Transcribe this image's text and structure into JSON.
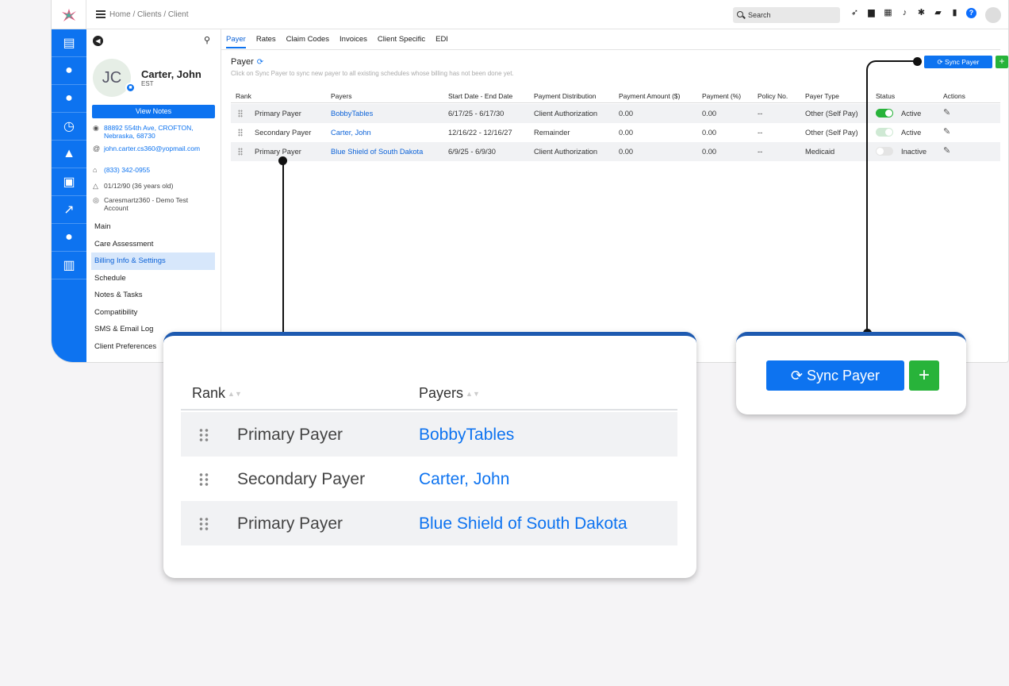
{
  "topbar": {
    "breadcrumb": "Home / Clients / Client",
    "search_placeholder": "Search",
    "icons": [
      "rocket-icon",
      "document-icon",
      "calendar-icon",
      "bell-icon",
      "gear-icon",
      "chat-icon",
      "bookmark-icon",
      "help-icon"
    ]
  },
  "rail": {
    "icons": [
      "dashboard-icon",
      "client-icon",
      "employee-icon",
      "schedule-icon",
      "lab-icon",
      "presentation-icon",
      "chart-icon",
      "user-settings-icon",
      "billing-icon"
    ]
  },
  "client": {
    "initials": "JC",
    "name": "Carter, John",
    "timezone": "EST",
    "view_notes": "View Notes",
    "address": "88892 554th Ave, CROFTON, Nebraska, 68730",
    "email": "john.carter.cs360@yopmail.com",
    "phone": "(833) 342-0955",
    "dob": "01/12/90 (36 years old)",
    "account": "Caresmartz360 - Demo Test Account"
  },
  "menu": [
    "Main",
    "Care Assessment",
    "Billing Info & Settings",
    "Schedule",
    "Notes & Tasks",
    "Compatibility",
    "SMS & Email Log",
    "Client Preferences"
  ],
  "active_menu": "Billing Info & Settings",
  "tabs": [
    "Payer",
    "Rates",
    "Claim Codes",
    "Invoices",
    "Client Specific",
    "EDI"
  ],
  "active_tab": "Payer",
  "payer_section": {
    "title": "Payer",
    "subtitle": "Click on Sync Payer to sync new payer to all existing schedules whose billing has not been done yet.",
    "sync_label": "Sync Payer",
    "add_label": "+"
  },
  "table": {
    "headers": [
      "Rank",
      "Payers",
      "Start Date - End Date",
      "Payment Distribution",
      "Payment Amount ($)",
      "Payment (%)",
      "Policy No.",
      "Payer Type",
      "Status",
      "Actions"
    ],
    "rows": [
      {
        "rank": "Primary Payer",
        "payer": "BobbyTables",
        "dates": "6/17/25 - 6/17/30",
        "distribution": "Client Authorization",
        "amount": "0.00",
        "percent": "0.00",
        "policy": "--",
        "type": "Other (Self Pay)",
        "status": "Active"
      },
      {
        "rank": "Secondary Payer",
        "payer": "Carter, John",
        "dates": "12/16/22 - 12/16/27",
        "distribution": "Remainder",
        "amount": "0.00",
        "percent": "0.00",
        "policy": "--",
        "type": "Other (Self Pay)",
        "status": "Active"
      },
      {
        "rank": "Primary Payer",
        "payer": "Blue Shield of South Dakota",
        "dates": "6/9/25 - 6/9/30",
        "distribution": "Client Authorization",
        "amount": "0.00",
        "percent": "0.00",
        "policy": "--",
        "type": "Medicaid",
        "status": "Inactive"
      }
    ]
  },
  "colors": {
    "primary": "#0d73f0",
    "success": "#28b33a",
    "accent_border": "#1e5ab0"
  }
}
